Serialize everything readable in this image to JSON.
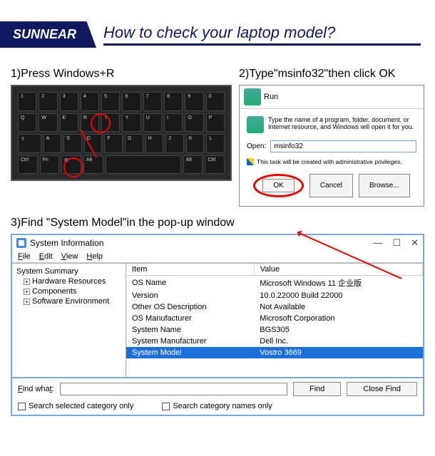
{
  "header": {
    "brand": "SUNNEAR",
    "title": "How to check your laptop model?"
  },
  "step1": {
    "label": "1)Press Windows+R"
  },
  "step2": {
    "label": "2)Type\"msinfo32\"then click OK"
  },
  "step3": {
    "label": "3)Find \"System Model\"in the pop-up window"
  },
  "run": {
    "title": "Run",
    "desc": "Type the name of a program, folder, document, or Internet resource, and Windows will open it for you.",
    "open_label": "Open:",
    "open_value": "msinfo32",
    "admin_note": "This task will be created with administrative privileges.",
    "ok": "OK",
    "cancel": "Cancel",
    "browse": "Browse..."
  },
  "sysinfo": {
    "title": "System Information",
    "menu": {
      "file": "File",
      "edit": "Edit",
      "view": "View",
      "help": "Help"
    },
    "tree": {
      "summary": "System Summary",
      "hw": "Hardware Resources",
      "comp": "Components",
      "sw": "Software Environment"
    },
    "cols": {
      "item": "Item",
      "value": "Value"
    },
    "rows": [
      {
        "item": "OS Name",
        "value": "Microsoft Windows 11 企业版"
      },
      {
        "item": "Version",
        "value": "10.0.22000 Build 22000"
      },
      {
        "item": "Other OS Description",
        "value": "Not Available"
      },
      {
        "item": "OS Manufacturer",
        "value": "Microsoft Corporation"
      },
      {
        "item": "System Name",
        "value": "BGS305"
      },
      {
        "item": "System Manufacturer",
        "value": "Dell Inc."
      },
      {
        "item": "System Model",
        "value": "Vostro 3669"
      }
    ],
    "find_label": "Find what:",
    "find_btn": "Find",
    "close_find": "Close Find",
    "chk1": "Search selected category only",
    "chk2": "Search category names only"
  }
}
